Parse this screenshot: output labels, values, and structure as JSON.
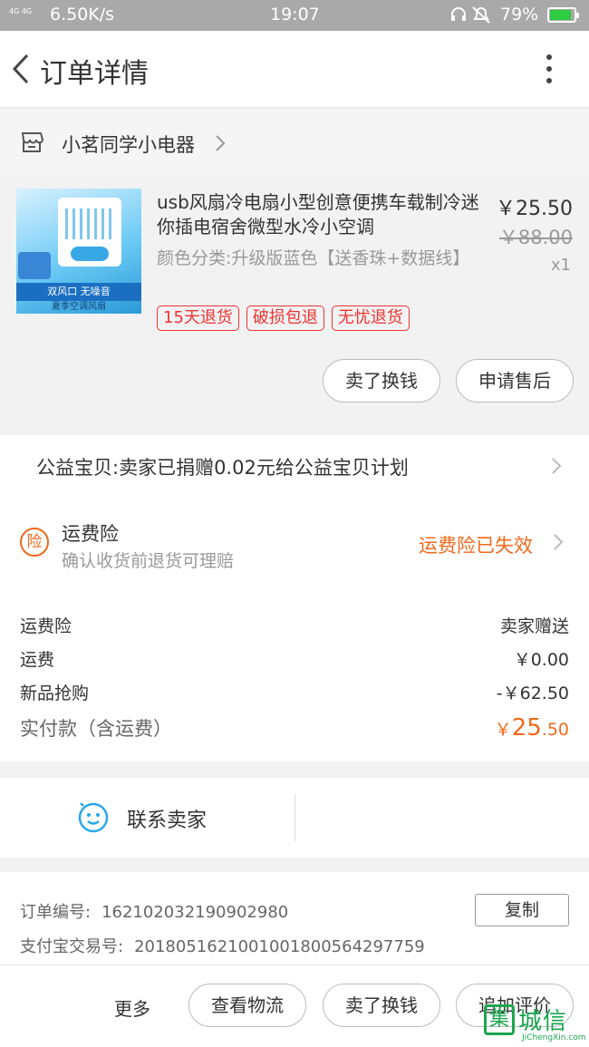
{
  "status_bar": {
    "network": "4G 4G",
    "speed": "6.50K/s",
    "time": "19:07",
    "battery": "79%",
    "accent": "#2ecc40"
  },
  "header": {
    "title": "订单详情",
    "back_icon": "chevron-left-icon",
    "more_icon": "more-vertical-icon"
  },
  "store": {
    "name": "小茗同学小电器",
    "icon": "shop-icon"
  },
  "product": {
    "title": "usb风扇冷电扇小型创意便携车载制冷迷你插电宿舍微型水冷小空调",
    "spec": "颜色分类:升级版蓝色【送香珠+数据线】",
    "price": "￥25.50",
    "original_price": "￥88.00",
    "quantity": "x1",
    "badges": [
      "15天退货",
      "破损包退",
      "无忧退货"
    ],
    "image_banner": "双风口 无噪音",
    "image_caption": "夏季空调风扇",
    "buttons": [
      "卖了换钱",
      "申请售后"
    ]
  },
  "charity": {
    "text": "公益宝贝:卖家已捐赠0.02元给公益宝贝计划"
  },
  "insurance": {
    "icon_text": "险",
    "title": "运费险",
    "subtitle": "确认收货前退货可理赔",
    "status": "运费险已失效",
    "accent": "#f06a1c"
  },
  "fees": {
    "rows": [
      {
        "label": "运费险",
        "value": "卖家赠送"
      },
      {
        "label": "运费",
        "value": "￥0.00"
      },
      {
        "label": "新品抢购",
        "value": "-￥62.50"
      }
    ],
    "total_label": "实付款（含运费）",
    "total_currency": "￥",
    "total_int": "25",
    "total_dec": ".50"
  },
  "contact": {
    "label": "联系卖家",
    "icon": "chat-bubble-icon"
  },
  "order_info": {
    "order_no_label": "订单编号:",
    "order_no": "162102032190902980",
    "alipay_label": "支付宝交易号:",
    "alipay_no": "2018051621001001800564297759",
    "copy_label": "复制"
  },
  "bottom_bar": {
    "more_label": "更多",
    "buttons": [
      "查看物流",
      "卖了换钱",
      "追加评价"
    ]
  },
  "watermark": {
    "logo_glyph": "集",
    "text": "城信",
    "url": "JiChengXin.com"
  }
}
